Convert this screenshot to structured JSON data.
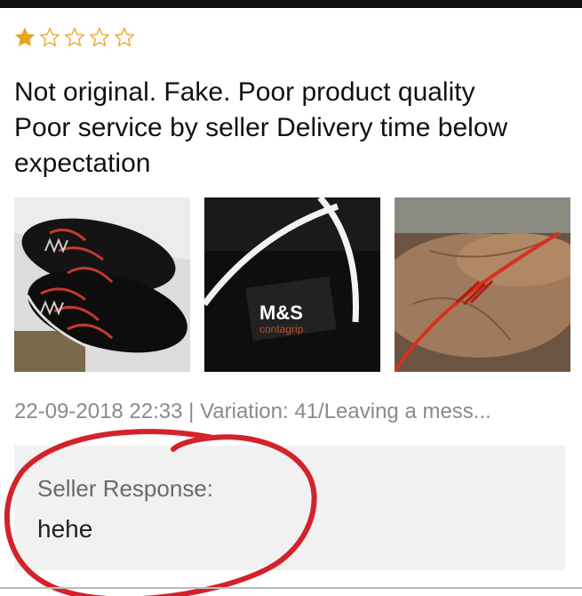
{
  "review": {
    "rating": 1,
    "max_rating": 5,
    "text_lines": [
      "Not original. Fake. Poor product quality",
      "Poor service by seller  Delivery time below",
      "expectation"
    ],
    "photos": [
      {
        "icon": "shoes-photo"
      },
      {
        "icon": "shoe-logo-closeup-photo",
        "brand_text": "M&S",
        "sub_text": "contagrip"
      },
      {
        "icon": "red-lace-in-hand-photo"
      }
    ],
    "meta": "22-09-2018 22:33 | Variation: 41/Leaving a mess..."
  },
  "seller_response": {
    "title": "Seller Response:",
    "body": "hehe"
  },
  "colors": {
    "star": "#e8a31c",
    "annotation_circle": "#d3222a",
    "response_bg": "#f1f1f1"
  }
}
